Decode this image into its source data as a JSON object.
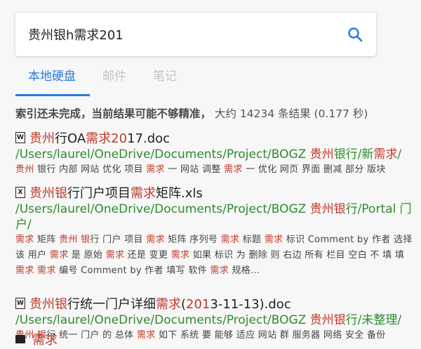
{
  "search": {
    "query": "贵州银h需求201"
  },
  "tabs": [
    {
      "label": "本地硬盘",
      "active": true
    },
    {
      "label": "邮件",
      "active": false
    },
    {
      "label": "笔记",
      "active": false
    }
  ],
  "status": {
    "notice": "索引还未完成，当前结果可能不够精准，",
    "count": "大约 14234 条结果 (0.177 秒)"
  },
  "results": [
    {
      "icon": "W",
      "title_parts": [
        [
          "贵州",
          true
        ],
        [
          "行OA",
          false
        ],
        [
          "需求",
          true
        ],
        [
          "20",
          true
        ],
        [
          "1",
          false
        ],
        [
          "7.doc",
          false
        ]
      ],
      "path_parts": [
        [
          "/Users/laurel/OneDrive/Documents/Project/BOGZ ",
          false
        ],
        [
          "贵州",
          true
        ],
        [
          "银行",
          false
        ],
        [
          "/新",
          false
        ],
        [
          "需求",
          true
        ],
        [
          "/",
          false
        ]
      ],
      "snippet_parts": [
        [
          "贵州",
          true
        ],
        [
          " 银行 内部 网站 优化 项目 ",
          false
        ],
        [
          "需求",
          true
        ],
        [
          " 一 网站 调整 ",
          false
        ],
        [
          "需求",
          true
        ],
        [
          " 一 优化 网页 界面 删减 部分 版块",
          false
        ]
      ]
    },
    {
      "icon": "X",
      "title_parts": [
        [
          "贵州银",
          true
        ],
        [
          "行门户项目",
          false
        ],
        [
          "需求",
          true
        ],
        [
          "矩阵.xls",
          false
        ]
      ],
      "path_parts": [
        [
          "/Users/laurel/OneDrive/Documents/Project/BOGZ ",
          false
        ],
        [
          "贵州银",
          true
        ],
        [
          "行/Portal 门户/",
          false
        ]
      ],
      "snippet_parts": [
        [
          "需求",
          true
        ],
        [
          " 矩阵 ",
          false
        ],
        [
          "贵州 银",
          true
        ],
        [
          "行 门户 项目 ",
          false
        ],
        [
          "需求",
          true
        ],
        [
          " 矩阵 序列号 ",
          false
        ],
        [
          "需求",
          true
        ],
        [
          " 标题 ",
          false
        ],
        [
          "需求",
          true
        ],
        [
          " 标识 Comment by 作者 选择 该 用户 ",
          false
        ],
        [
          "需求",
          true
        ],
        [
          " 是 原始 ",
          false
        ],
        [
          "需求",
          true
        ],
        [
          " 还是 变更 ",
          false
        ],
        [
          "需求",
          true
        ],
        [
          " 如果 标识 为 删除 则 右边 所有 栏目 空白 不 填 填 ",
          false
        ],
        [
          "需求 需求",
          true
        ],
        [
          " 编号 Comment by 作者 填写 软件 ",
          false
        ],
        [
          "需求",
          true
        ],
        [
          " 规格...",
          false
        ]
      ]
    },
    {
      "icon": "W",
      "title_parts": [
        [
          "贵州银",
          true
        ],
        [
          "行统一门户详细",
          false
        ],
        [
          "需求",
          true
        ],
        [
          "(",
          false
        ],
        [
          "201",
          true
        ],
        [
          "3-11-13).doc",
          false
        ]
      ],
      "path_parts": [
        [
          "/Users/laurel/OneDrive/Documents/Project/BOGZ ",
          false
        ],
        [
          "贵州银",
          true
        ],
        [
          "行/未整理/",
          false
        ]
      ],
      "snippet_parts": [
        [
          "贵州 银",
          true
        ],
        [
          "行 统一 门户 的 总体 ",
          false
        ],
        [
          "需求",
          true
        ],
        [
          " 如下 系统 要 能够 适应 网站 群 服务器 网络 安全 备份",
          false
        ]
      ]
    }
  ],
  "partial_result": {
    "title": "需求"
  },
  "colors": {
    "accent": "#2878e0",
    "highlight": "#c0392b",
    "path": "#2e8b2e"
  }
}
